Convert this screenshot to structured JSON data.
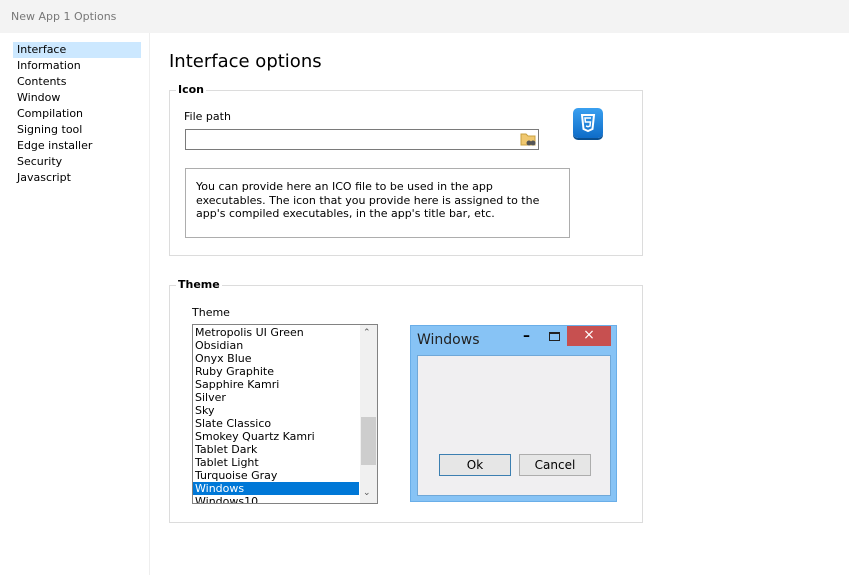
{
  "window": {
    "title": "New App 1 Options"
  },
  "sidebar": {
    "items": [
      {
        "label": "Interface",
        "selected": true
      },
      {
        "label": "Information"
      },
      {
        "label": "Contents"
      },
      {
        "label": "Window"
      },
      {
        "label": "Compilation"
      },
      {
        "label": "Signing tool"
      },
      {
        "label": "Edge installer"
      },
      {
        "label": "Security"
      },
      {
        "label": "Javascript"
      }
    ]
  },
  "main": {
    "title": "Interface options",
    "icon_group": {
      "legend": "Icon",
      "file_path_label": "File path",
      "file_path_value": "",
      "browse_icon": "folder-search-icon",
      "preview_icon": "html5-icon",
      "note": "You can provide here an ICO file to be used in the app executables. The icon that you provide here is assigned to the app's compiled executables, in the app's title bar, etc."
    },
    "theme_group": {
      "legend": "Theme",
      "theme_label": "Theme",
      "themes": [
        "Metropolis UI Green",
        "Obsidian",
        "Onyx Blue",
        "Ruby Graphite",
        "Sapphire Kamri",
        "Silver",
        "Sky",
        "Slate Classico",
        "Smokey Quartz Kamri",
        "Tablet Dark",
        "Tablet Light",
        "Turquoise Gray",
        "Windows",
        "Windows10"
      ],
      "selected": "Windows",
      "preview": {
        "title": "Windows",
        "ok": "Ok",
        "cancel": "Cancel",
        "close_glyph": "×",
        "minimize_glyph": "–"
      }
    }
  },
  "colors": {
    "selection": "#0078d7",
    "sidebar_selection": "#cce8ff",
    "preview_frame": "#87c3f5",
    "close_button": "#c75050"
  }
}
